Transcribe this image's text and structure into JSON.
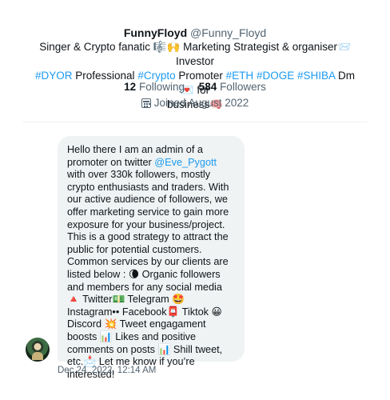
{
  "profile": {
    "display_name": "FunnyFloyd",
    "handle": "@Funny_Floyd",
    "bio_line1": "Singer & Crypto fanatic 🎼🙌 Marketing Strategist & organiser📨 Investor",
    "bio_tags": [
      "#DYOR",
      "#Crypto",
      "#ETH",
      "#DOGE",
      "#SHIBA"
    ],
    "bio_word_professional": "Professional",
    "bio_word_promoter": "Promoter",
    "bio_dm": "Dm💌 for",
    "bio_line3": "business🧠",
    "following_count": "12",
    "following_label": "Following",
    "followers_count": "584",
    "followers_label": "Followers",
    "joined": "Joined August 2022"
  },
  "message": {
    "text_before_mention": "Hello there I am an admin of a promoter on twitter ",
    "mention": "@Eve_Pygott",
    "text_after_mention": " with over 330k followers, mostly crypto enthusiasts and traders. With our active audience of followers, we offer marketing service to gain more exposure for your business/project. This is a good strategy to attract the public for potential customers. Common services by our clients are listed below : 🌘 Organic followers and members for any social media 🔺 Twitter💵 Telegram 🤩 Instagram•• Facebook📮 Tiktok 😀 Discord 💥 Tweet engagament boosts 📊 Likes and positive comments on posts 📊 Shill tweet, etc.📩 Let me know if you’re interested!",
    "timestamp": "Dec 24, 2022, 12:14 AM"
  },
  "icons": {
    "calendar": "calendar-icon",
    "avatar": "avatar"
  },
  "colors": {
    "accent": "#1d9bf0",
    "secondary_text": "#536471",
    "bubble_bg": "#eff3f4"
  }
}
